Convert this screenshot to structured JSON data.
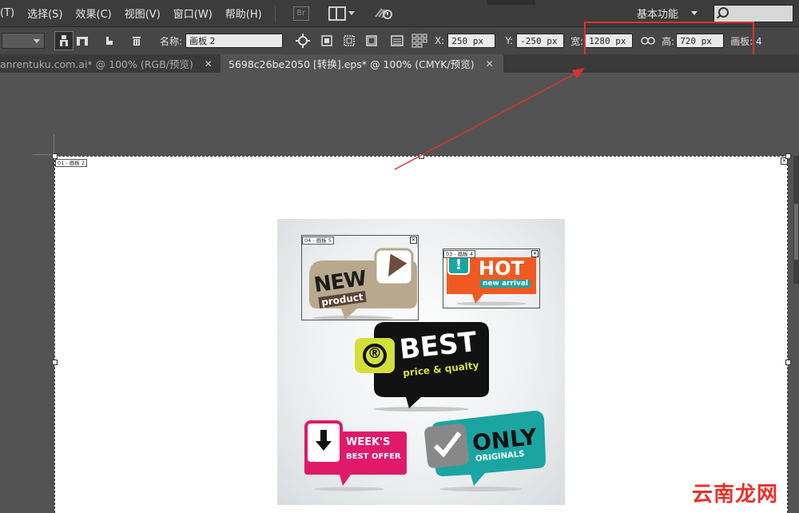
{
  "menu": {
    "items": [
      "(T)",
      "选择(S)",
      "效果(C)",
      "视图(V)",
      "窗口(W)",
      "帮助(H)"
    ],
    "bridge_label": "Br",
    "workspace_label": "基本功能"
  },
  "control_bar": {
    "name_label": "名称:",
    "name_value": "画板 2",
    "x_label": "X:",
    "x_value": "250 px",
    "y_label": "Y:",
    "y_value": "-250 px",
    "width_label": "宽:",
    "width_value": "1280 px",
    "height_label": "高:",
    "height_value": "720 px",
    "artboards_label": "画板: 4"
  },
  "tabs": [
    {
      "title": "anrentuku.com.ai* @ 100% (RGB/预览)",
      "active": false
    },
    {
      "title": "5698c26be2050 [转换].eps* @ 100% (CMYK/预览)",
      "active": true
    }
  ],
  "artboard": {
    "main_label": "01 - 画板 2",
    "sub_labels": [
      "04 - 画板 5",
      "03 - 画板 4"
    ]
  },
  "artwork": {
    "new": {
      "big": "NEW",
      "small": "product"
    },
    "hot": {
      "big": "HOT",
      "small": "new arrival"
    },
    "best": {
      "big": "BEST",
      "small": "price & qualty",
      "mark": "®"
    },
    "weeks": {
      "big": "WEEK'S",
      "small": "BEST OFFER"
    },
    "only": {
      "big": "ONLY",
      "small": "ORIGINALS"
    }
  },
  "colors": {
    "highlight": "#e03030",
    "tan": "#b8a98e",
    "orange": "#f05a22",
    "teal": "#1aa5a2",
    "magenta": "#e0196b",
    "yellow": "#d4e03a"
  },
  "watermark": "云南龙网"
}
